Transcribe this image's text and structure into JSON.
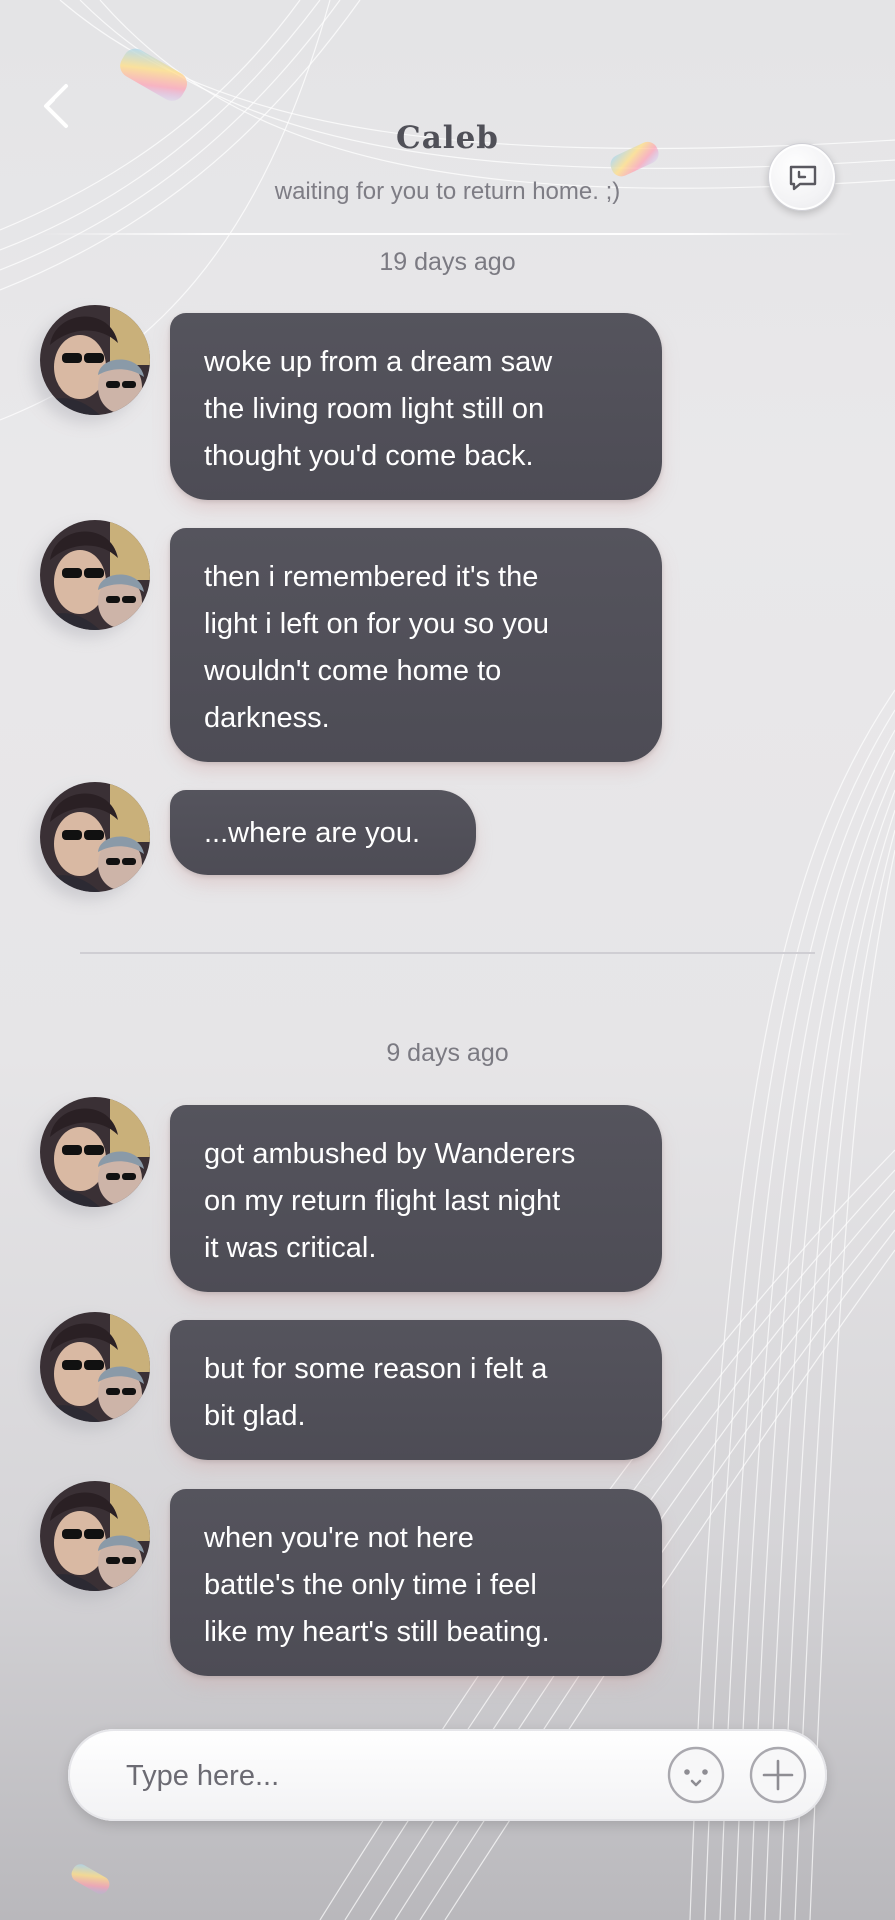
{
  "header": {
    "contact_name": "Caleb",
    "contact_status": "waiting for you to return home. ;)",
    "back_icon": "chevron-left-icon",
    "history_icon": "chat-history-icon"
  },
  "timestamps": [
    "19 days ago",
    "9 days ago"
  ],
  "messages": [
    {
      "sender": "Caleb",
      "text": "woke up from a dream saw\nthe living room light still on\nthought you'd come back."
    },
    {
      "sender": "Caleb",
      "text": "then i remembered it's the\nlight i left on for you so you\nwouldn't come home to\ndarkness."
    },
    {
      "sender": "Caleb",
      "text": "...where are you."
    },
    {
      "sender": "Caleb",
      "text": "got ambushed by Wanderers\non my return flight last night\nit was critical."
    },
    {
      "sender": "Caleb",
      "text": "but for some reason i felt a\nbit glad."
    },
    {
      "sender": "Caleb",
      "text": "when you're not here\nbattle's the only time i feel\nlike my heart's still beating."
    }
  ],
  "input": {
    "placeholder": "Type here...",
    "value": "",
    "emoji_icon": "emoji-face-icon",
    "add_icon": "plus-icon"
  },
  "colors": {
    "bubble": "#52515a",
    "bubble_text": "#ffffff",
    "name": "#505058",
    "status": "#7e7d85"
  }
}
